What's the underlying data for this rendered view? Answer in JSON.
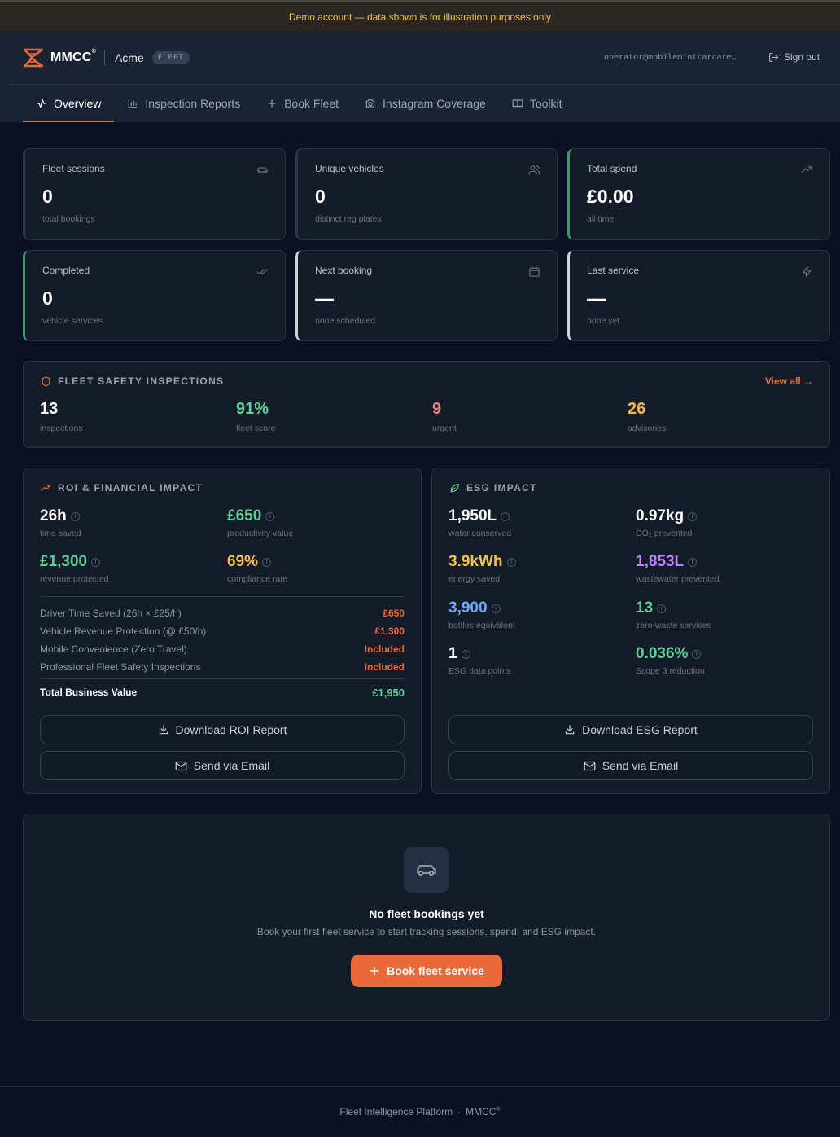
{
  "banner": {
    "text": "Demo account — data shown is for illustration purposes only"
  },
  "header": {
    "brand": "MMCC",
    "brand_mark": "®",
    "org": "Acme",
    "badge": "FLEET",
    "user_email": "operator@mobilemintcarcare…",
    "sign_out": "Sign out"
  },
  "tabs": [
    {
      "label": "Overview",
      "icon": "activity-icon"
    },
    {
      "label": "Inspection Reports",
      "icon": "bar-chart-icon"
    },
    {
      "label": "Book Fleet",
      "icon": "plus-icon"
    },
    {
      "label": "Instagram Coverage",
      "icon": "camera-icon"
    },
    {
      "label": "Toolkit",
      "icon": "book-icon"
    }
  ],
  "stats": [
    {
      "label": "Fleet sessions",
      "value": "0",
      "sub": "total bookings",
      "icon": "car-icon"
    },
    {
      "label": "Unique vehicles",
      "value": "0",
      "sub": "distinct reg plates",
      "icon": "users-icon"
    },
    {
      "label": "Total spend",
      "value": "£0.00",
      "sub": "all time",
      "icon": "trending-up-icon"
    },
    {
      "label": "Completed",
      "value": "0",
      "sub": "vehicle services",
      "icon": "check-check-icon"
    },
    {
      "label": "Next booking",
      "value": "—",
      "sub": "none scheduled",
      "icon": "calendar-icon"
    },
    {
      "label": "Last service",
      "value": "—",
      "sub": "none yet",
      "icon": "zap-icon"
    }
  ],
  "inspections": {
    "title": "FLEET SAFETY INSPECTIONS",
    "view_all": "View all →",
    "items": [
      {
        "value": "13",
        "label": "inspections"
      },
      {
        "value": "91%",
        "label": "fleet score"
      },
      {
        "value": "9",
        "label": "urgent"
      },
      {
        "value": "26",
        "label": "advisories"
      }
    ]
  },
  "roi": {
    "title": "ROI & FINANCIAL IMPACT",
    "metrics": [
      {
        "value": "26h",
        "label": "time saved"
      },
      {
        "value": "£650",
        "label": "productivity value"
      },
      {
        "value": "£1,300",
        "label": "revenue protected"
      },
      {
        "value": "69%",
        "label": "compliance rate"
      }
    ],
    "rows": [
      {
        "label": "Driver Time Saved (26h × £25/h)",
        "amount": "£650"
      },
      {
        "label": "Vehicle Revenue Protection (@ £50/h)",
        "amount": "£1,300"
      },
      {
        "label": "Mobile Convenience (Zero Travel)",
        "amount": "Included"
      },
      {
        "label": "Professional Fleet Safety Inspections",
        "amount": "Included"
      }
    ],
    "total_label": "Total Business Value",
    "total_value": "£1,950",
    "download": "Download ROI Report",
    "email": "Send via Email"
  },
  "esg": {
    "title": "ESG IMPACT",
    "metrics": [
      {
        "value": "1,950L",
        "label": "water conserved"
      },
      {
        "value": "0.97kg",
        "label": "CO₂ prevented"
      },
      {
        "value": "3.9kWh",
        "label": "energy saved"
      },
      {
        "value": "1,853L",
        "label": "wastewater prevented"
      },
      {
        "value": "3,900",
        "label": "bottles equivalent"
      },
      {
        "value": "13",
        "label": "zero-waste services"
      },
      {
        "value": "1",
        "label": "ESG data points"
      },
      {
        "value": "0.036%",
        "label": "Scope 3 reduction"
      }
    ],
    "download": "Download ESG Report",
    "email": "Send via Email"
  },
  "empty": {
    "title": "No fleet bookings yet",
    "text": "Book your first fleet service to start tracking sessions, spend, and ESG impact.",
    "cta": "Book fleet service"
  },
  "footer": {
    "text": "Fleet Intelligence Platform",
    "sep": "·",
    "brand": "MMCC",
    "mark": "®"
  },
  "colors": {
    "accent": "#e8693a",
    "green": "#5fcf96",
    "banner_text": "#f2c14a"
  }
}
